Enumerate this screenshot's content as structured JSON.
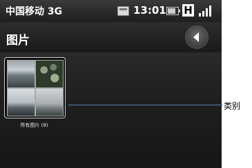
{
  "status_bar": {
    "carrier": "中国移动 3G",
    "time": "13:01",
    "network_type": "H",
    "battery_level": 0.8,
    "icons": [
      "sd-card-icon",
      "battery-icon",
      "network-type-icon",
      "signal-strength-icon"
    ]
  },
  "header": {
    "title": "图片",
    "back_icon": "back-arrow-icon"
  },
  "albums": [
    {
      "label": "所有图片 (8)"
    }
  ],
  "annotation": {
    "label": "类别",
    "line_color": "#5a7fb0"
  }
}
